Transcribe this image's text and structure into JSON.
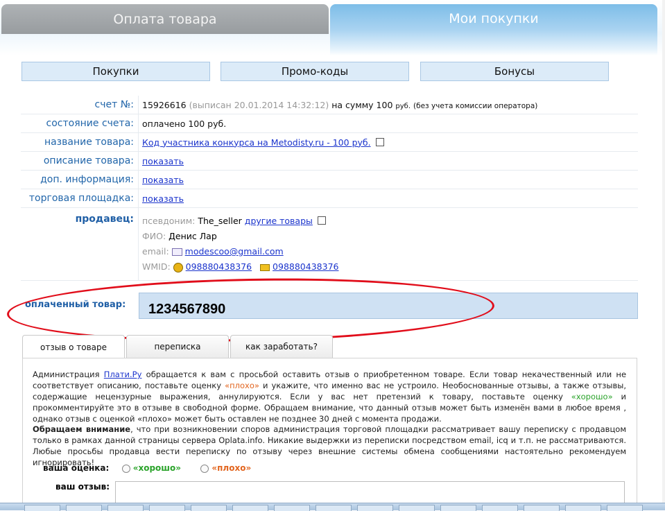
{
  "main_tabs": {
    "payment": "Оплата товара",
    "my_purchases": "Мои покупки"
  },
  "sub_nav": {
    "purchases": "Покупки",
    "promo": "Промо-коды",
    "bonuses": "Бонусы"
  },
  "invoice": {
    "label": "счет №:",
    "number": "15926616",
    "issued": "(выписан 20.01.2014 14:32:12)",
    "amount_text": "на сумму 100",
    "currency": "руб.",
    "fee_note": "(без учета комиссии оператора)"
  },
  "status": {
    "label": "состояние счета:",
    "value": "оплачено 100 руб."
  },
  "product_name": {
    "label": "название товара:",
    "value": "Код участника конкурса на Metodisty.ru - 100 руб."
  },
  "product_desc": {
    "label": "описание товара:",
    "link": "показать"
  },
  "extra_info": {
    "label": "доп. информация:",
    "link": "показать"
  },
  "marketplace": {
    "label": "торговая площадка:",
    "link": "показать"
  },
  "seller": {
    "label": "продавец:",
    "nick_label": "псевдоним:",
    "nick": "The_seller",
    "other_goods": "другие товары",
    "fio_label": "ФИО:",
    "fio": "Денис Лар",
    "email_label": "email:",
    "email": "modescoo@gmail.com",
    "wmid_label": "WMID:",
    "wmid1": "098880438376",
    "wmid2": "098880438376"
  },
  "paid_goods": {
    "label": "оплаченный товар:",
    "value": "1234567890"
  },
  "tabs": {
    "review": "отзыв о товаре",
    "correspondence": "переписка",
    "earn": "как заработать?"
  },
  "notice": {
    "p1_a": "Администрация",
    "p1_link": "Плати.Ру",
    "p1_b": "обращается к вам с просьбой оставить отзыв о приобретенном товаре. Если товар некачественный или не соответствует описанию, поставьте оценку",
    "bad_word": "«плохо»",
    "p1_c": "и укажите, что именно вас не устроило. Необоснованные отзывы, а также отзывы, содержащие нецензурные выражения, аннулируются. Если у вас нет претензий к товару, поставьте оценку",
    "good_word": "«хорошо»",
    "p1_d": "и прокомментируйте это в отзыве в свободной форме. Обращаем внимание, что данный отзыв может быть изменён вами в любое время , однако отзыв с оценкой «плохо» может быть оставлен не позднее 30 дней с момента продажи.",
    "p2_bold": "Обращаем внимание",
    "p2_text": ", что при возникновении споров администрация торговой площадки рассматривает вашу переписку с продавцом только в рамках данной страницы сервера Oplata.info. Никакие выдержки из переписки посредством email, icq и т.п. не рассматриваются. Любые просьбы продавца вести переписку по отзыву через внешние системы обмена сообщениями настоятельно рекомендуем игнорировать!"
  },
  "rating": {
    "label": "ваша оценка:",
    "good": "«хорошо»",
    "bad": "«плохо»"
  },
  "review": {
    "label": "ваш отзыв:"
  }
}
